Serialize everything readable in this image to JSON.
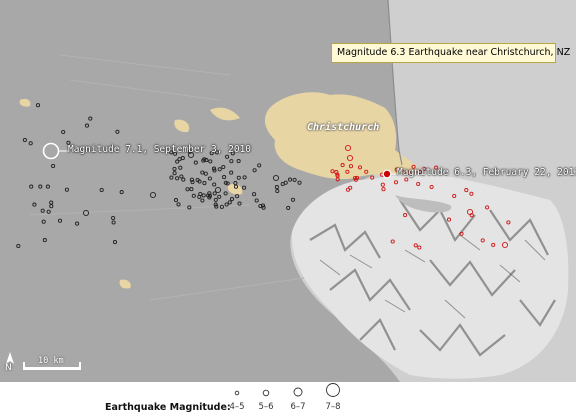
{
  "title": "Magnitude 6.3 Earthquake near Christchurch, NZ",
  "city_label": "Christchurch",
  "mainshock_2010": {
    "label": "Magnitude 7.1, September 3, 2010",
    "magnitude": 7.1
  },
  "mainshock_2011": {
    "label": "Magnitude 6.3, February 22, 2011",
    "magnitude": 6.3
  },
  "scale_bar": {
    "label": "10 km",
    "length_km": 10
  },
  "north_arrow": {
    "label": "N",
    "icon": "north-arrow-icon"
  },
  "legend": {
    "title": "Earthquake Magnitude:",
    "items": [
      {
        "label": "4–5",
        "size_class": 1
      },
      {
        "label": "5–6",
        "size_class": 2
      },
      {
        "label": "6–7",
        "size_class": 3
      },
      {
        "label": "7–8",
        "size_class": 4
      }
    ]
  },
  "colors": {
    "plain": "#a9a9a9",
    "sea": "#cdcdcd",
    "urban": "#e8d5a4",
    "aftershock_2010": "#222222",
    "aftershock_2011": "#d01818",
    "mainshock_2011_fill": "#cc0000"
  }
}
